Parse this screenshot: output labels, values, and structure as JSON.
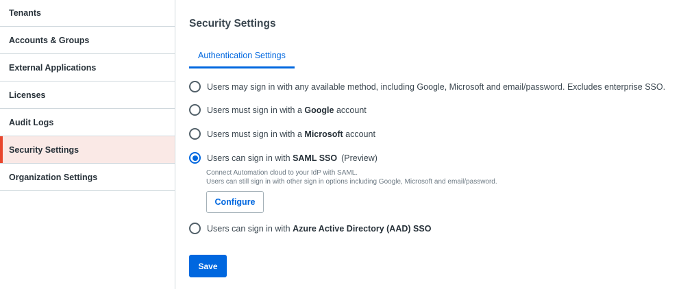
{
  "sidebar": {
    "items": [
      {
        "label": "Tenants"
      },
      {
        "label": "Accounts & Groups"
      },
      {
        "label": "External Applications"
      },
      {
        "label": "Licenses"
      },
      {
        "label": "Audit Logs"
      },
      {
        "label": "Security Settings"
      },
      {
        "label": "Organization Settings"
      }
    ]
  },
  "main": {
    "title": "Security Settings",
    "tabs": [
      {
        "label": "Authentication Settings"
      }
    ],
    "options": {
      "any": {
        "text": "Users may sign in with any available method, including Google, Microsoft and email/password. Excludes enterprise SSO."
      },
      "google": {
        "prefix": "Users must sign in with a ",
        "strong": "Google",
        "suffix": " account"
      },
      "microsoft": {
        "prefix": "Users must sign in with a ",
        "strong": "Microsoft",
        "suffix": " account"
      },
      "saml": {
        "prefix": "Users can sign in with ",
        "strong": "SAML SSO",
        "badge": "(Preview)",
        "desc1": "Connect Automation cloud to your IdP with SAML.",
        "desc2": "Users can still sign in with other sign in options including Google, Microsoft and email/password."
      },
      "aad": {
        "prefix": "Users can sign in with ",
        "strong": "Azure Active Directory (AAD) SSO"
      }
    },
    "configure_label": "Configure",
    "save_label": "Save"
  },
  "colors": {
    "accent": "#0067df",
    "active_marker": "#e8452c",
    "active_bg": "#fae9e6"
  }
}
